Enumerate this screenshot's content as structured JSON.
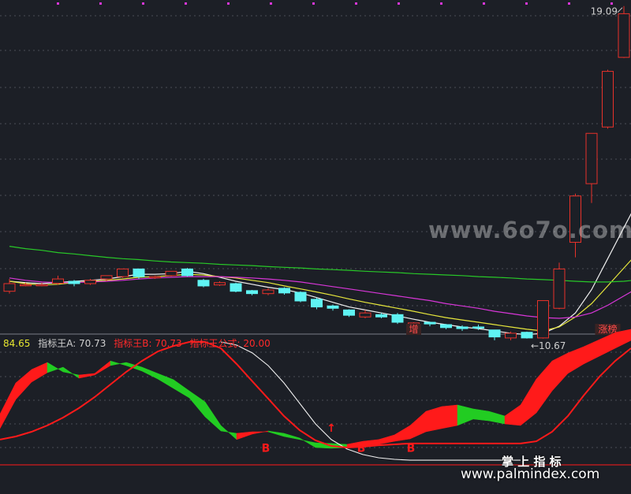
{
  "colors": {
    "background": "#1c1f26",
    "grid": "#4a4d57",
    "up": "#e8322a",
    "down": "#5ff3f3",
    "ma_white": "#f0f0f0",
    "ma_yellow": "#e6e63c",
    "ma_magenta": "#d836d8",
    "ma_green": "#28c828",
    "ind_red": "#ff1a1a",
    "ind_green": "#22cc22",
    "text_gray": "#d0d0d0",
    "value_yellow": "#e6e630"
  },
  "labels": {
    "high_price": "19.09",
    "low_price": "←10.67",
    "zeng": "增",
    "zhangbang": "涨榜",
    "watermark": "www.6o7o.com",
    "brand_cn": "掌 上 指 标",
    "brand_url": "www.palmindex.com"
  },
  "indicator": {
    "value": "84.65",
    "a": "指标王A: 70.73",
    "b": "指标王B: 70.73",
    "formula": "指标王公式: 20.00"
  },
  "chart_data": [
    {
      "type": "candlestick",
      "title": "",
      "ylim": [
        10,
        19.6
      ],
      "annotations": [
        {
          "text": "19.09",
          "kind": "high",
          "candle": 38
        },
        {
          "text": "←10.67",
          "kind": "low",
          "candle": 32
        },
        {
          "text": "增",
          "kind": "tag",
          "candle": 25
        },
        {
          "text": "涨榜",
          "kind": "tag",
          "candle": 37
        }
      ],
      "candles": [
        {
          "o": 11.0,
          "c": 11.23,
          "h": 11.37,
          "l": 10.93
        },
        {
          "o": 11.2,
          "c": 11.2,
          "h": 11.26,
          "l": 11.15
        },
        {
          "o": 11.2,
          "c": 11.2,
          "h": 11.26,
          "l": 11.15
        },
        {
          "o": 11.24,
          "c": 11.37,
          "h": 11.47,
          "l": 11.19
        },
        {
          "o": 11.3,
          "c": 11.23,
          "h": 11.34,
          "l": 11.15
        },
        {
          "o": 11.23,
          "c": 11.33,
          "h": 11.37,
          "l": 11.19
        },
        {
          "o": 11.37,
          "c": 11.47,
          "h": 11.47,
          "l": 11.3
        },
        {
          "o": 11.44,
          "c": 11.67,
          "h": 11.67,
          "l": 11.4
        },
        {
          "o": 11.67,
          "c": 11.44,
          "h": 11.67,
          "l": 11.37
        },
        {
          "o": 11.44,
          "c": 11.44,
          "h": 11.47,
          "l": 11.37
        },
        {
          "o": 11.47,
          "c": 11.6,
          "h": 11.6,
          "l": 11.44
        },
        {
          "o": 11.67,
          "c": 11.47,
          "h": 11.7,
          "l": 11.44
        },
        {
          "o": 11.33,
          "c": 11.16,
          "h": 11.37,
          "l": 11.12
        },
        {
          "o": 11.19,
          "c": 11.26,
          "h": 11.3,
          "l": 11.16
        },
        {
          "o": 11.23,
          "c": 11.0,
          "h": 11.26,
          "l": 10.97
        },
        {
          "o": 11.02,
          "c": 10.93,
          "h": 11.04,
          "l": 10.88
        },
        {
          "o": 10.93,
          "c": 11.04,
          "h": 11.09,
          "l": 10.88
        },
        {
          "o": 11.09,
          "c": 10.95,
          "h": 11.12,
          "l": 10.9
        },
        {
          "o": 10.97,
          "c": 10.71,
          "h": 11.0,
          "l": 10.67
        },
        {
          "o": 10.76,
          "c": 10.53,
          "h": 10.81,
          "l": 10.46
        },
        {
          "o": 10.56,
          "c": 10.49,
          "h": 10.6,
          "l": 10.42
        },
        {
          "o": 10.44,
          "c": 10.28,
          "h": 10.46,
          "l": 10.23
        },
        {
          "o": 10.23,
          "c": 10.35,
          "h": 10.44,
          "l": 10.19
        },
        {
          "o": 10.3,
          "c": 10.23,
          "h": 10.35,
          "l": 10.19
        },
        {
          "o": 10.3,
          "c": 10.07,
          "h": 10.35,
          "l": 10.02
        },
        {
          "o": 9.88,
          "c": 10.05,
          "h": 10.07,
          "l": 9.86
        },
        {
          "o": 10.07,
          "c": 10.02,
          "h": 10.09,
          "l": 9.95
        },
        {
          "o": 10.0,
          "c": 9.91,
          "h": 10.02,
          "l": 9.86
        },
        {
          "o": 9.93,
          "c": 9.88,
          "h": 9.98,
          "l": 9.81
        },
        {
          "o": 9.93,
          "c": 9.91,
          "h": 10.0,
          "l": 9.84
        },
        {
          "o": 9.84,
          "c": 9.63,
          "h": 9.84,
          "l": 9.53
        },
        {
          "o": 9.6,
          "c": 9.74,
          "h": 9.79,
          "l": 9.53
        },
        {
          "o": 9.77,
          "c": 9.6,
          "h": 9.79,
          "l": 9.58
        },
        {
          "o": 9.6,
          "c": 10.72,
          "h": 10.72,
          "l": 9.58
        },
        {
          "o": 10.49,
          "c": 11.67,
          "h": 11.86,
          "l": 10.46
        },
        {
          "o": 12.47,
          "c": 13.86,
          "h": 13.93,
          "l": 12.02
        },
        {
          "o": 14.23,
          "c": 15.74,
          "h": 15.74,
          "l": 13.65
        },
        {
          "o": 15.93,
          "c": 17.6,
          "h": 17.65,
          "l": 15.88
        },
        {
          "o": 18.02,
          "c": 19.33,
          "h": 19.56,
          "l": 18.0
        }
      ],
      "ma": [
        {
          "name": "",
          "color": "white",
          "values": [
            11.3,
            11.26,
            11.23,
            11.26,
            11.3,
            11.33,
            11.37,
            11.44,
            11.51,
            11.51,
            11.53,
            11.6,
            11.53,
            11.42,
            11.3,
            11.21,
            11.12,
            11.05,
            10.95,
            10.81,
            10.67,
            10.53,
            10.44,
            10.35,
            10.26,
            10.16,
            10.07,
            10.0,
            9.93,
            9.88,
            9.81,
            9.74,
            9.7,
            9.74,
            9.95,
            10.35,
            11.05,
            11.98,
            12.91,
            13.84,
            14.77,
            15.7
          ]
        },
        {
          "name": "",
          "color": "yellow",
          "values": [
            11.3,
            11.23,
            11.19,
            11.21,
            11.26,
            11.3,
            11.33,
            11.37,
            11.42,
            11.44,
            11.47,
            11.51,
            11.49,
            11.44,
            11.4,
            11.33,
            11.26,
            11.16,
            11.07,
            10.98,
            10.88,
            10.77,
            10.67,
            10.58,
            10.49,
            10.4,
            10.3,
            10.21,
            10.14,
            10.07,
            10.0,
            9.93,
            9.86,
            9.81,
            9.93,
            10.23,
            10.63,
            11.16,
            11.7,
            12.23,
            12.79
          ]
        },
        {
          "name": "",
          "color": "magenta",
          "values": [
            11.4,
            11.33,
            11.28,
            11.26,
            11.26,
            11.28,
            11.3,
            11.33,
            11.37,
            11.4,
            11.42,
            11.44,
            11.44,
            11.44,
            11.42,
            11.4,
            11.37,
            11.33,
            11.28,
            11.21,
            11.14,
            11.07,
            11.0,
            10.93,
            10.86,
            10.79,
            10.72,
            10.63,
            10.56,
            10.49,
            10.4,
            10.33,
            10.26,
            10.21,
            10.19,
            10.23,
            10.35,
            10.58,
            10.86,
            11.14,
            11.44
          ]
        },
        {
          "name": "",
          "color": "green",
          "values": [
            12.35,
            12.28,
            12.23,
            12.16,
            12.12,
            12.07,
            12.02,
            11.98,
            11.95,
            11.91,
            11.88,
            11.86,
            11.84,
            11.81,
            11.79,
            11.77,
            11.74,
            11.72,
            11.7,
            11.67,
            11.65,
            11.63,
            11.6,
            11.58,
            11.56,
            11.53,
            11.51,
            11.49,
            11.47,
            11.44,
            11.42,
            11.4,
            11.37,
            11.35,
            11.33,
            11.3,
            11.28,
            11.28,
            11.3,
            11.35,
            11.44
          ]
        }
      ]
    },
    {
      "type": "area",
      "title": "",
      "ylim": [
        0,
        100
      ],
      "x": [
        0,
        20,
        40,
        60,
        80,
        100,
        120,
        140,
        160,
        180,
        200,
        220,
        240,
        260,
        280,
        300,
        320,
        340,
        360,
        380,
        400,
        420,
        440,
        460,
        480,
        500,
        520,
        540,
        560,
        580,
        600,
        620,
        640,
        660,
        680,
        700,
        720,
        740,
        760,
        780,
        800
      ],
      "series": [
        {
          "name": "",
          "role": "band_top",
          "values": [
            42.5,
            68.4,
            79.6,
            85.5,
            77.6,
            75,
            76.3,
            86.8,
            82.9,
            78.3,
            71.7,
            63.8,
            55.9,
            40.1,
            28.3,
            26.3,
            27.6,
            27.6,
            23.7,
            21.1,
            18.4,
            17.8,
            17.1,
            19.7,
            21.1,
            25,
            32.9,
            44.7,
            48.7,
            50,
            46.7,
            44.7,
            40.8,
            50,
            71.7,
            86.8,
            93.4,
            98.7,
            104.6,
            110.5,
            113.2
          ]
        },
        {
          "name": "",
          "role": "band_bottom",
          "values": [
            30.3,
            54.6,
            69.1,
            77,
            81.6,
            72.4,
            75,
            82.9,
            85.5,
            81.6,
            76.3,
            71.1,
            61.8,
            52.6,
            32.9,
            21.1,
            25.7,
            28.3,
            26.3,
            22.4,
            14.5,
            13.8,
            14.5,
            15.8,
            17.1,
            19.7,
            21.7,
            27.6,
            30.3,
            32.9,
            38.2,
            36.8,
            34.2,
            32.9,
            43.4,
            61.8,
            76.3,
            84.2,
            90.8,
            97.4,
            103.9
          ]
        },
        {
          "name": "",
          "role": "red_line",
          "values": [
            21.1,
            23.7,
            27.6,
            32.9,
            39.5,
            47.4,
            56.6,
            67.1,
            77.6,
            86.8,
            94.7,
            99.3,
            102.6,
            102.6,
            97.4,
            84.2,
            69.7,
            55.3,
            40.8,
            28.9,
            20.4,
            15.8,
            14.5,
            15.1,
            16.4,
            17.1,
            17.8,
            17.8,
            17.8,
            17.8,
            17.8,
            17.8,
            17.8,
            17.8,
            19.7,
            27.6,
            40.8,
            57.9,
            73.7,
            86.8,
            97.4
          ]
        },
        {
          "name": "",
          "role": "white_line",
          "values": [
            null,
            null,
            null,
            null,
            null,
            null,
            null,
            null,
            null,
            null,
            null,
            null,
            null,
            null,
            102.6,
            100,
            93.4,
            82.9,
            68.4,
            51.3,
            34.2,
            21.1,
            13.2,
            8.6,
            5.9,
            4.6,
            3.9,
            3.9,
            3.9,
            3.9,
            3.9,
            3.9,
            3.9,
            3.9,
            null,
            null,
            null,
            null,
            null,
            null,
            null
          ]
        }
      ],
      "markers": [
        {
          "text": "↑",
          "x": 420,
          "value": 31
        },
        {
          "text": "B",
          "x": 337,
          "value": 14
        },
        {
          "text": "B",
          "x": 458,
          "value": 14
        },
        {
          "text": "B",
          "x": 521,
          "value": 14
        }
      ]
    }
  ]
}
